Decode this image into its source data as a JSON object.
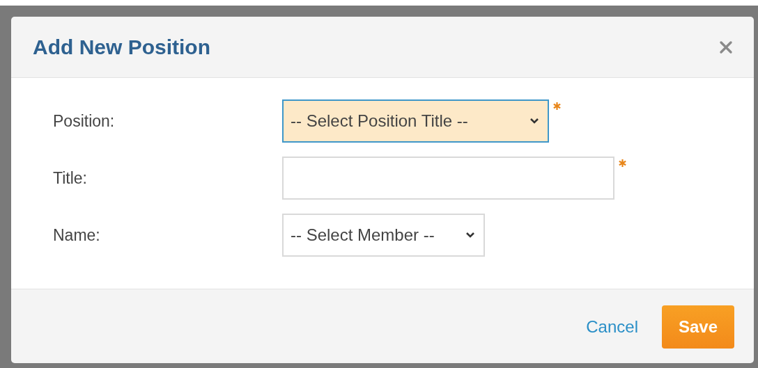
{
  "dialog": {
    "title": "Add New Position",
    "fields": [
      {
        "label": "Position:",
        "kind": "select",
        "value": "-- Select Position Title --",
        "required": true,
        "focused": true
      },
      {
        "label": "Title:",
        "kind": "text",
        "required": true,
        "focused": false
      },
      {
        "label": "Name:",
        "kind": "select",
        "value": "-- Select Member --",
        "required": false,
        "focused": false
      }
    ],
    "buttons": [
      {
        "label": "Cancel",
        "kind": "link"
      },
      {
        "label": "Save",
        "kind": "primary"
      }
    ]
  }
}
